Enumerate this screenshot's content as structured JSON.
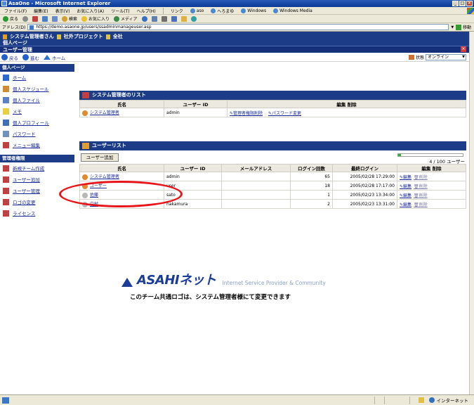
{
  "window": {
    "title": "AsaOne - Microsoft Internet Explorer"
  },
  "menubar": {
    "items": [
      "ファイル(F)",
      "編集(E)",
      "表示(V)",
      "お気に入り(A)",
      "ツール(T)",
      "ヘルプ(H)"
    ],
    "links_label": "リンク",
    "links": [
      "aso",
      "へろまゆ",
      "Windows",
      "Windows Media"
    ]
  },
  "toolbar": {
    "back": "戻る",
    "search": "検索",
    "favorites": "お気に入り",
    "media": "メディア"
  },
  "address": {
    "label": "アドレス(D)",
    "url": "https://demo.asaone.jp/users/ssadminmanageuser.asp",
    "go": "移動"
  },
  "header": {
    "user": "システム管理者さん",
    "project_tag": "社外プロジェクト",
    "company_tag": "全社",
    "personal_page": "個人ページ",
    "section": "ユーザー管理"
  },
  "nav": {
    "back": "戻る",
    "forward": "進む",
    "home": "ホーム"
  },
  "status": {
    "label": "状態",
    "value": "オンライン"
  },
  "sidebar": {
    "personal_head": "個人ページ",
    "personal_items": [
      {
        "label": "ホーム",
        "icon": "home-icon",
        "color": "#2a6ad0"
      },
      {
        "label": "個人スケジュール",
        "icon": "calendar-icon",
        "color": "#d08a30"
      },
      {
        "label": "個人ファイル",
        "icon": "file-icon",
        "color": "#5a80c8"
      },
      {
        "label": "メモ",
        "icon": "memo-icon",
        "color": "#e8d040"
      },
      {
        "label": "個人プロフィール",
        "icon": "profile-icon",
        "color": "#4070b8"
      },
      {
        "label": "パスワード",
        "icon": "password-icon",
        "color": "#7090c0"
      },
      {
        "label": "メニュー編集",
        "icon": "menu-edit-icon",
        "color": "#c04040"
      }
    ],
    "admin_head": "管理者権限",
    "admin_items": [
      {
        "label": "新規チーム作成",
        "icon": "tools-icon",
        "color": "#c04040"
      },
      {
        "label": "ユーザー追加",
        "icon": "tools-icon",
        "color": "#c04040"
      },
      {
        "label": "ユーザー管理",
        "icon": "tools-icon",
        "color": "#c04040"
      },
      {
        "label": "ロゴの変更",
        "icon": "tools-icon",
        "color": "#c04040"
      },
      {
        "label": "ライセンス",
        "icon": "tools-icon",
        "color": "#c04040"
      }
    ]
  },
  "admin_list": {
    "title": "システム管理者のリスト",
    "headers": [
      "氏名",
      "ユーザー ID",
      "編集 削除"
    ],
    "rows": [
      {
        "name": "システム管理者",
        "id": "admin",
        "action1": "管理者権限削除",
        "action2": "パスワード変更"
      }
    ]
  },
  "user_list": {
    "title": "ユーザーリスト",
    "add_button": "ユーザー追加",
    "pager_text": "4 / 100  ユーザー",
    "pager_fraction": 0.04,
    "headers": [
      "氏名",
      "ユーザー ID",
      "メールアドレス",
      "ログイン回数",
      "最終ログイン",
      "編集 削除"
    ],
    "rows": [
      {
        "name": "システム管理者",
        "id": "admin",
        "email": "",
        "logins": "65",
        "last": "2005/02/28 17:29:00",
        "edit": "編集",
        "del": "削除"
      },
      {
        "name": "ユーザー",
        "id": "user",
        "email": "",
        "logins": "18",
        "last": "2005/02/28 17:17:00",
        "edit": "編集",
        "del": "削除"
      },
      {
        "name": "佐藤",
        "id": "sato",
        "email": "",
        "logins": "1",
        "last": "2005/02/23 13:34:00",
        "edit": "編集",
        "del": "削除"
      },
      {
        "name": "中村",
        "id": "nakamura",
        "email": "",
        "logins": "2",
        "last": "2005/02/23 13:31:00",
        "edit": "編集",
        "del": "削除"
      }
    ]
  },
  "footer": {
    "logo_text": "ASAHIネット",
    "tagline": "Internet Service Provider & Community",
    "notice": "このチーム共通ロゴは、システム管理者様にて変更できます"
  },
  "statusbar": {
    "zone": "インターネット"
  }
}
